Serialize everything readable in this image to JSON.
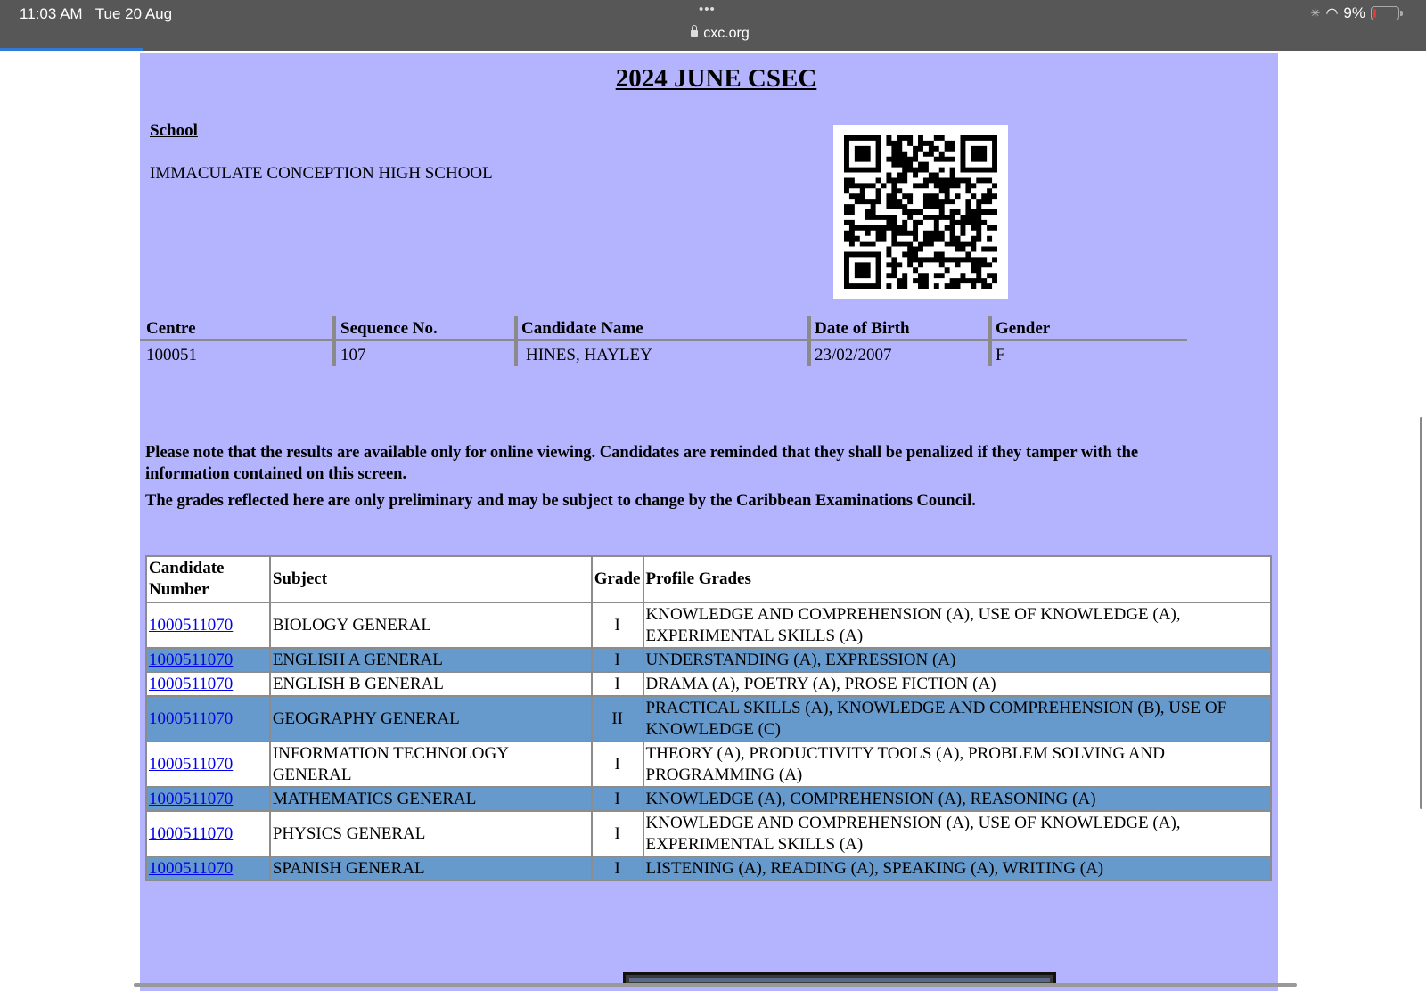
{
  "status_bar": {
    "time": "11:03 AM",
    "date": "Tue 20 Aug",
    "dots": "•••",
    "url": "cxc.org",
    "wifi_icon": "◠",
    "battery_percent": "9%",
    "loading_icon": "✳"
  },
  "page": {
    "title": "2024 JUNE CSEC",
    "school_label": "School",
    "school_name": "IMMACULATE CONCEPTION HIGH SCHOOL",
    "info_headers": {
      "centre": "Centre",
      "sequence": "Sequence No.",
      "candidate_name": "Candidate Name",
      "dob": "Date of Birth",
      "gender": "Gender"
    },
    "info_values": {
      "centre": "100051",
      "sequence": "107",
      "candidate_name": "HINES, HAYLEY",
      "dob": "23/02/2007",
      "gender": "F"
    },
    "notice_1": "Please note that the results are available only for online viewing. Candidates are reminded that they shall be penalized if they tamper with the information contained on this screen.",
    "notice_2": "The grades reflected here are only preliminary and may be subject to change by the Caribbean Examinations Council."
  },
  "results": {
    "headers": {
      "candidate_number": "Candidate Number",
      "subject": "Subject",
      "grade": "Grade",
      "profile": "Profile Grades"
    },
    "rows": [
      {
        "candidate_number": "1000511070",
        "subject": "BIOLOGY GENERAL",
        "grade": "I",
        "profile": "KNOWLEDGE AND COMPREHENSION (A), USE OF KNOWLEDGE (A), EXPERIMENTAL SKILLS (A)"
      },
      {
        "candidate_number": "1000511070",
        "subject": "ENGLISH A GENERAL",
        "grade": "I",
        "profile": "UNDERSTANDING (A), EXPRESSION (A)"
      },
      {
        "candidate_number": "1000511070",
        "subject": "ENGLISH B GENERAL",
        "grade": "I",
        "profile": "DRAMA (A), POETRY (A), PROSE FICTION (A)"
      },
      {
        "candidate_number": "1000511070",
        "subject": "GEOGRAPHY GENERAL",
        "grade": "II",
        "profile": "PRACTICAL SKILLS (A), KNOWLEDGE AND COMPREHENSION (B), USE OF KNOWLEDGE (C)"
      },
      {
        "candidate_number": "1000511070",
        "subject": "INFORMATION TECHNOLOGY GENERAL",
        "grade": "I",
        "profile": "THEORY (A), PRODUCTIVITY TOOLS (A), PROBLEM SOLVING AND PROGRAMMING (A)"
      },
      {
        "candidate_number": "1000511070",
        "subject": "MATHEMATICS GENERAL",
        "grade": "I",
        "profile": "KNOWLEDGE (A), COMPREHENSION (A), REASONING (A)"
      },
      {
        "candidate_number": "1000511070",
        "subject": "PHYSICS GENERAL",
        "grade": "I",
        "profile": "KNOWLEDGE AND COMPREHENSION (A), USE OF KNOWLEDGE (A), EXPERIMENTAL SKILLS (A)"
      },
      {
        "candidate_number": "1000511070",
        "subject": "SPANISH GENERAL",
        "grade": "I",
        "profile": "LISTENING (A), READING (A), SPEAKING (A), WRITING (A)"
      }
    ]
  },
  "colors": {
    "page_background": "#b3b3fe",
    "row_highlight": "#6699cc",
    "link": "#0000ee",
    "status_bar": "#575757"
  }
}
